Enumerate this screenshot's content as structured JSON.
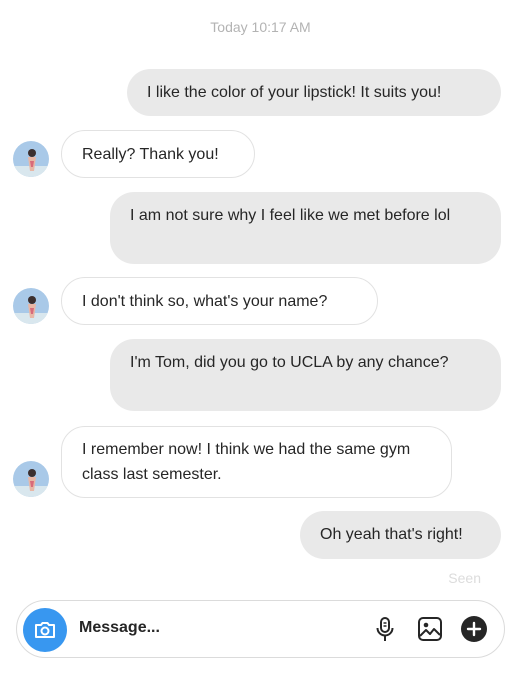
{
  "header": {
    "timestamp": "Today 10:17 AM"
  },
  "messages": [
    {
      "direction": "sent",
      "text": "I like the color of your lipstick! It suits you!"
    },
    {
      "direction": "received",
      "text": "Really? Thank you!"
    },
    {
      "direction": "sent",
      "text": "I am not sure why I feel like we met before lol"
    },
    {
      "direction": "received",
      "text": "I don't think so, what's your name?"
    },
    {
      "direction": "sent",
      "text": "I'm Tom, did you go to UCLA by any chance?"
    },
    {
      "direction": "received",
      "text": "I remember now! I think we had the same gym class last semester."
    },
    {
      "direction": "sent",
      "text": "Oh yeah that's right!"
    }
  ],
  "status": {
    "seen": "Seen"
  },
  "composer": {
    "placeholder": "Message...",
    "icons": {
      "camera": "camera-icon",
      "microphone": "microphone-icon",
      "gallery": "image-icon",
      "add": "plus-circle-icon"
    }
  },
  "colors": {
    "sent_bubble": "#e9e9e9",
    "received_border": "#e2e2e2",
    "camera_button": "#3897f0",
    "timestamp": "#b3b3b3"
  }
}
